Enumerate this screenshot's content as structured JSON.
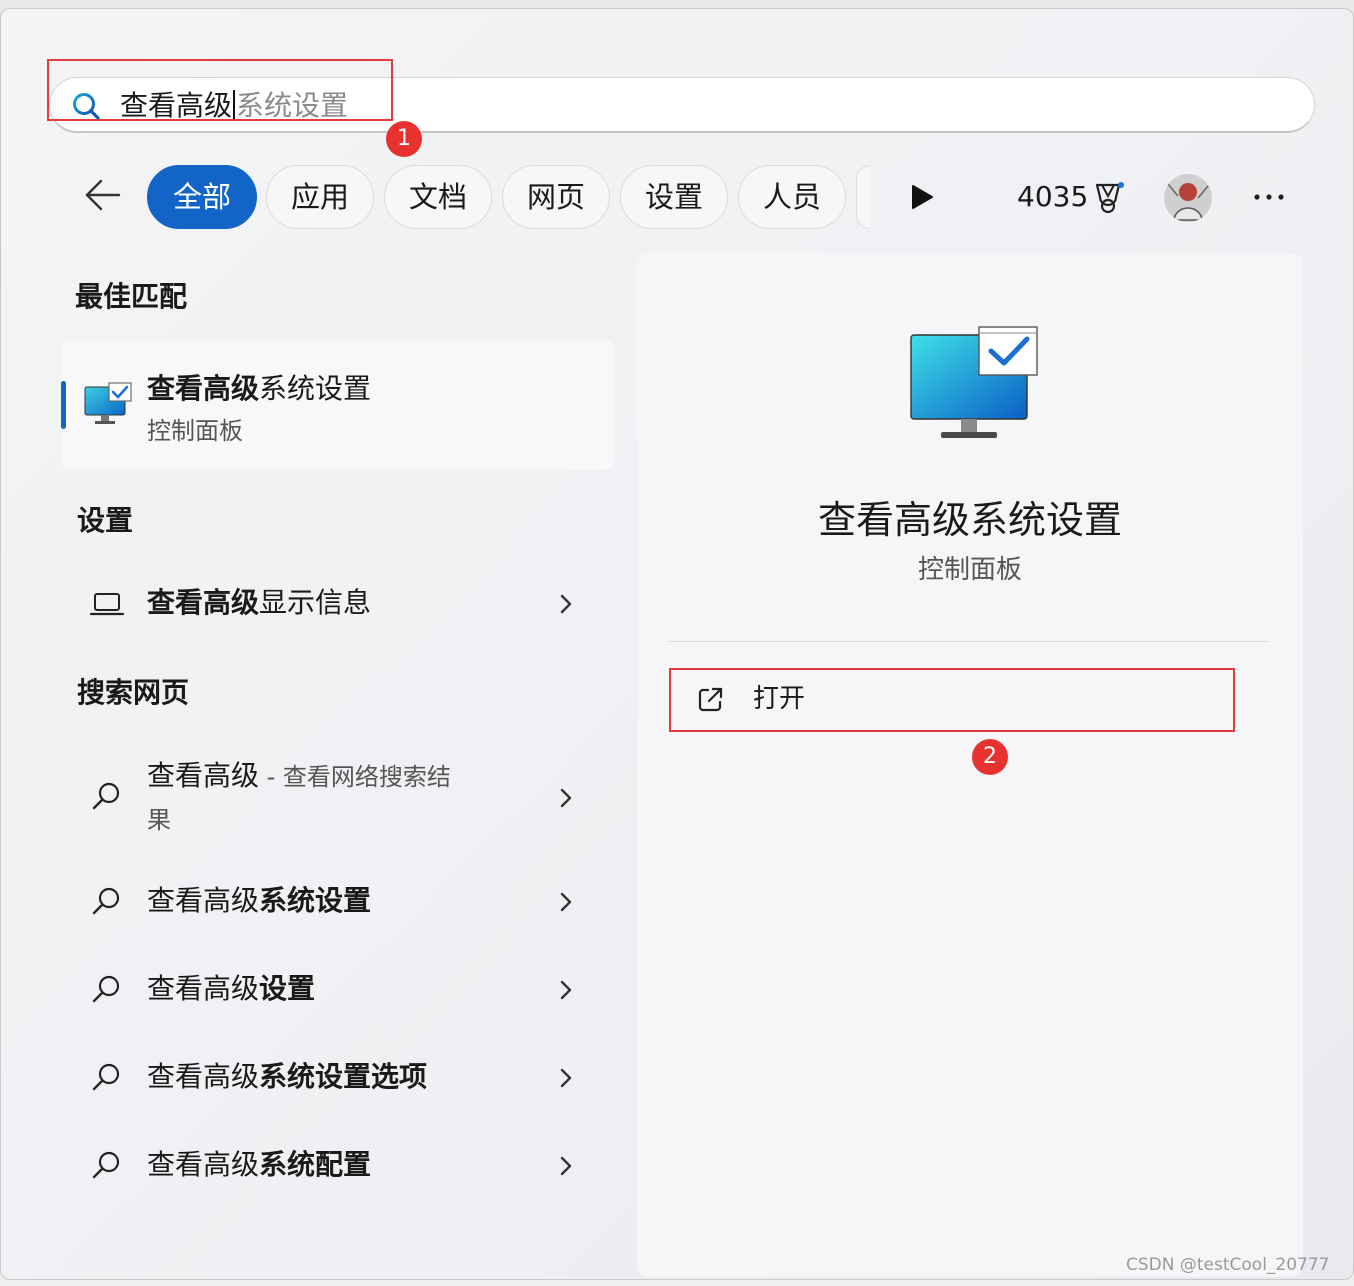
{
  "search": {
    "typed": "查看高级",
    "suggestion": "系统设置"
  },
  "filters": {
    "tabs": [
      "全部",
      "应用",
      "文档",
      "网页",
      "设置",
      "人员"
    ],
    "points": "4035"
  },
  "best_match": {
    "heading": "最佳匹配",
    "title_bold": "查看高级",
    "title_rest": "系统设置",
    "subtitle": "控制面板"
  },
  "settings_section": {
    "heading": "设置",
    "item_bold": "查看高级",
    "item_rest": "显示信息"
  },
  "web_section": {
    "heading": "搜索网页",
    "items": [
      {
        "plain": "查看高级",
        "bold": "",
        "suffix": " - 查看网络搜索结",
        "line2": "果"
      },
      {
        "plain": "查看高级",
        "bold": "系统设置"
      },
      {
        "plain": "查看高级",
        "bold": "设置"
      },
      {
        "plain": "查看高级",
        "bold": "系统设置选项"
      },
      {
        "plain": "查看高级",
        "bold": "系统配置"
      }
    ]
  },
  "detail": {
    "title": "查看高级系统设置",
    "subtitle": "控制面板",
    "action_label": "打开"
  },
  "annotations": [
    "1",
    "2"
  ],
  "watermark": "CSDN @testCool_20777",
  "colors": {
    "accent": "#1264c6",
    "annotation_red": "#e23b3b"
  }
}
